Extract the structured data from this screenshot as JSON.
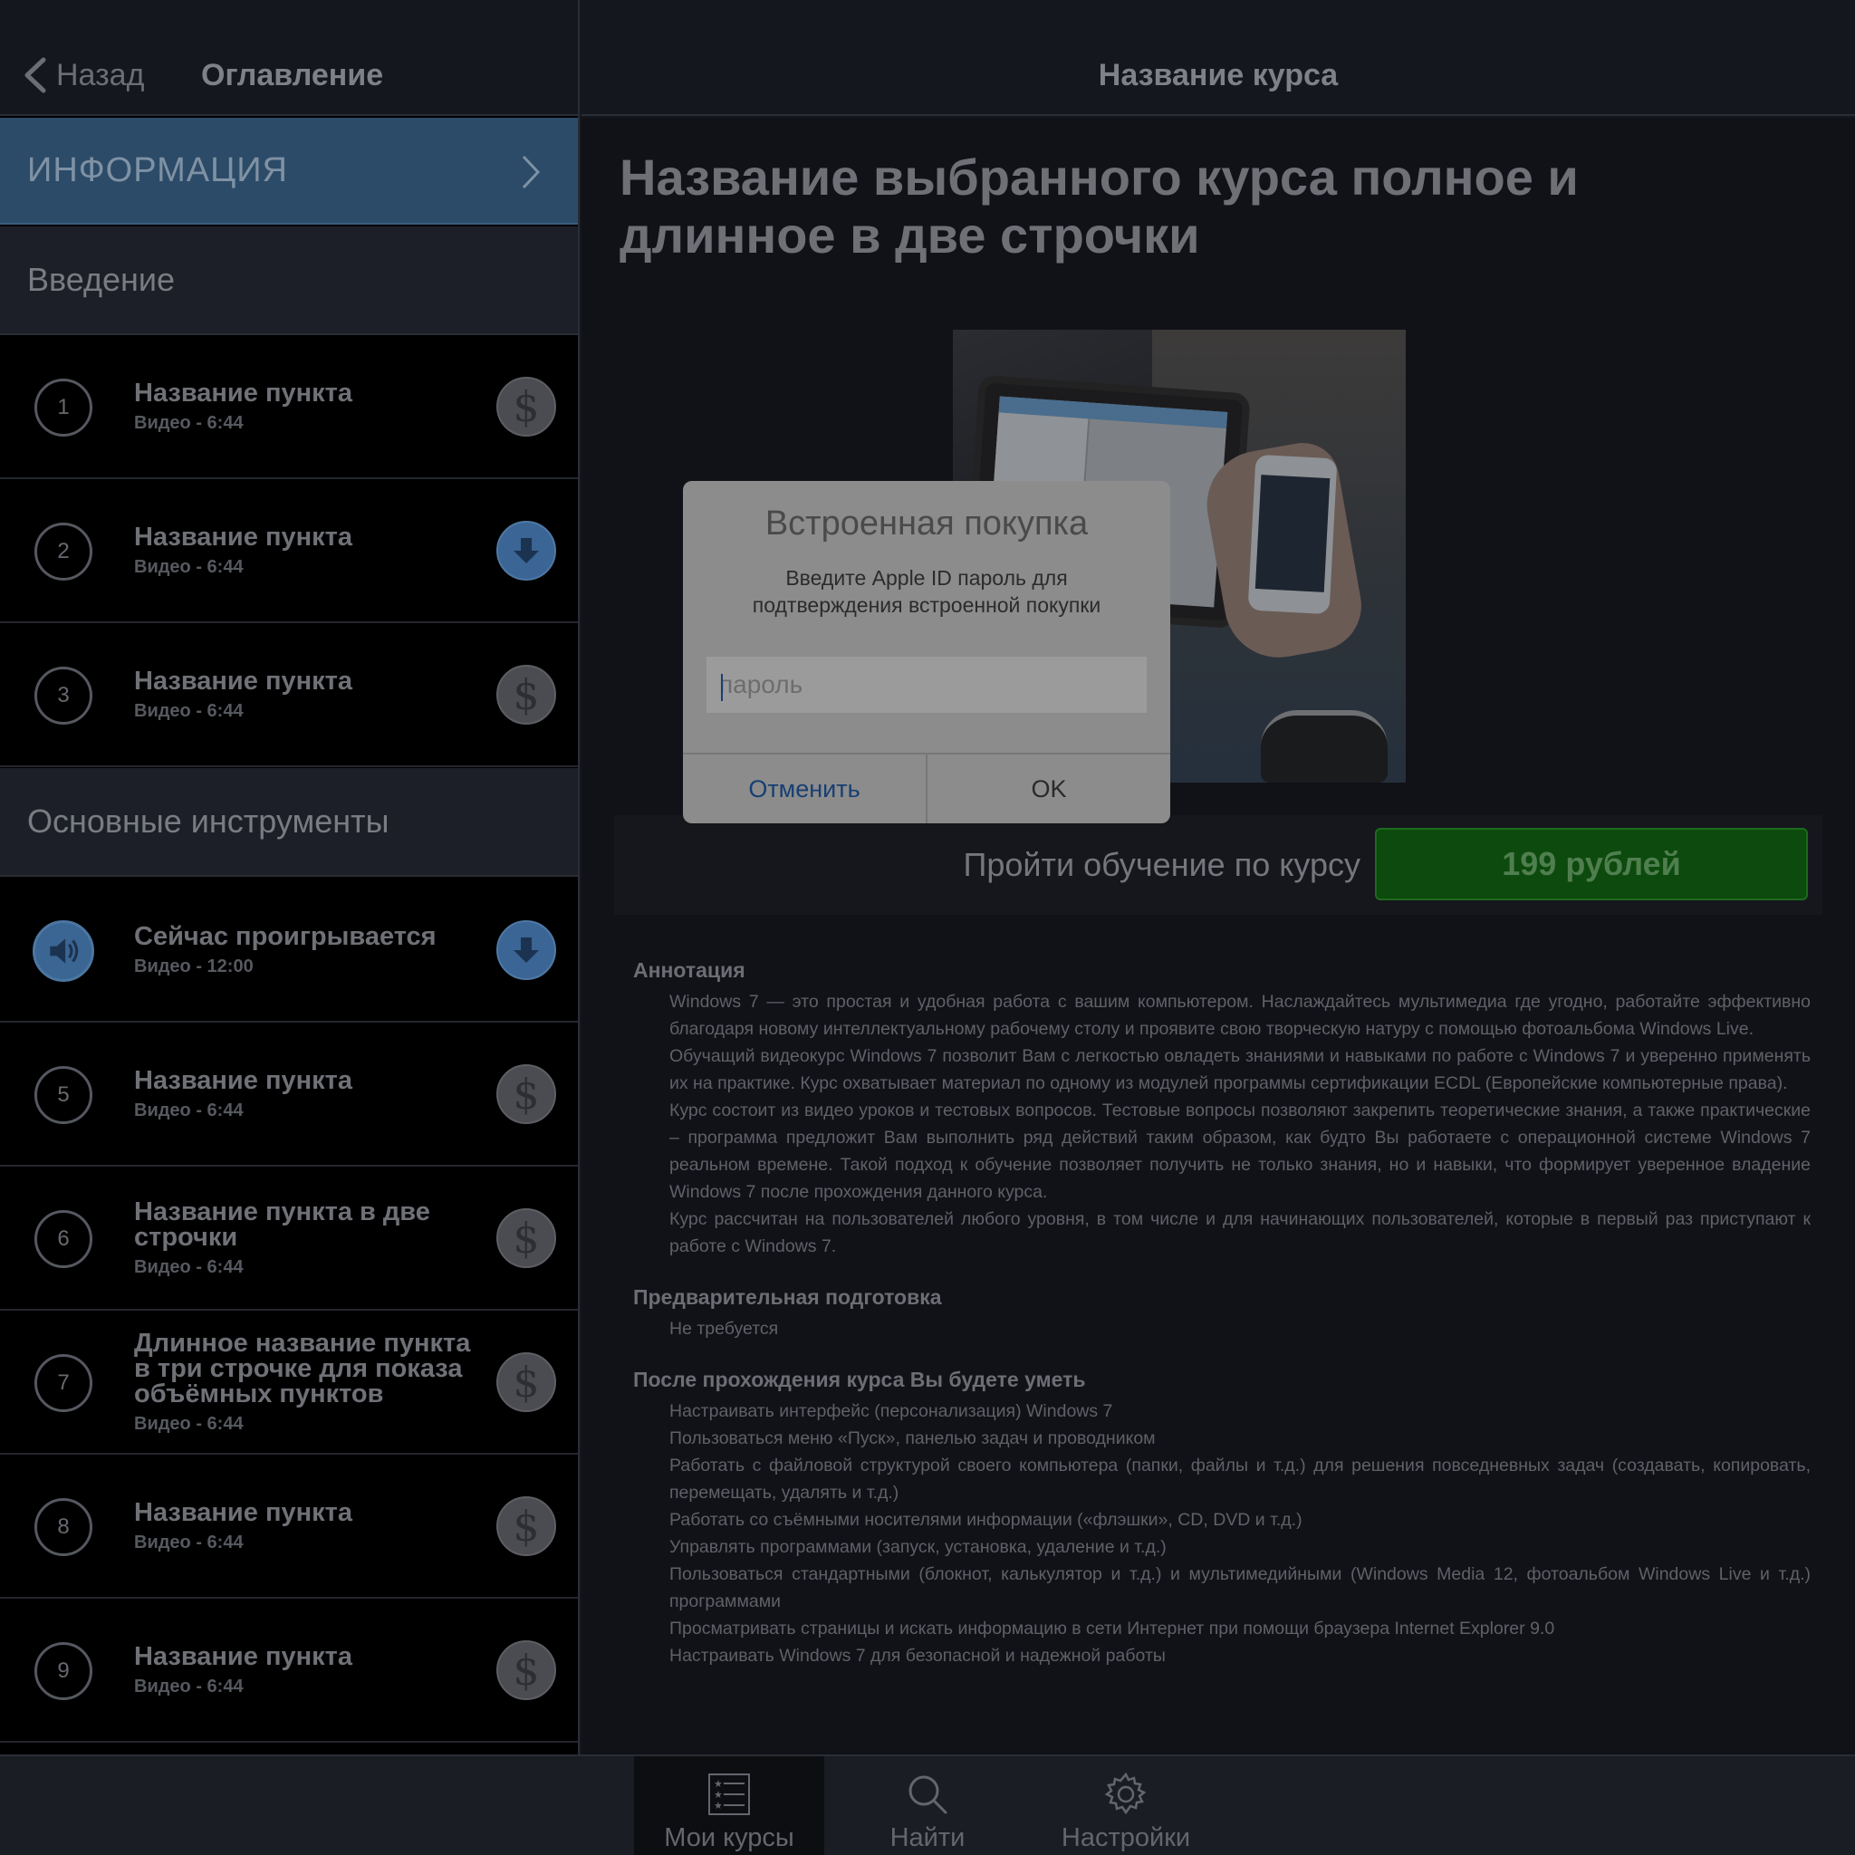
{
  "sidebar": {
    "back_label": "Назад",
    "title": "Оглавление",
    "info_label": "ИНФОРМАЦИЯ",
    "sections": [
      {
        "title": "Введение"
      },
      {
        "title": "Основные инструменты"
      }
    ],
    "lessons": [
      {
        "number": "1",
        "title": "Название пункта",
        "subtitle": "Видео - 6:44",
        "action": "dollar-icon"
      },
      {
        "number": "2",
        "title": "Название пункта",
        "subtitle": "Видео - 6:44",
        "action": "download-icon"
      },
      {
        "number": "3",
        "title": "Название пункта",
        "subtitle": "Видео - 6:44",
        "action": "dollar-icon"
      },
      {
        "number": "",
        "title": "Сейчас проигрывается",
        "subtitle": "Видео - 12:00",
        "action": "download-icon",
        "playing": true
      },
      {
        "number": "5",
        "title": "Название пункта",
        "subtitle": "Видео - 6:44",
        "action": "dollar-icon"
      },
      {
        "number": "6",
        "title": "Название пункта в две строчки",
        "subtitle": "Видео - 6:44",
        "action": "dollar-icon"
      },
      {
        "number": "7",
        "title": "Длинное название пункта в три строчке для показа объёмных пунктов",
        "subtitle": "Видео - 6:44",
        "action": "dollar-icon"
      },
      {
        "number": "8",
        "title": "Название пункта",
        "subtitle": "Видео - 6:44",
        "action": "dollar-icon"
      },
      {
        "number": "9",
        "title": "Название пункта",
        "subtitle": "Видео - 6:44",
        "action": "dollar-icon"
      }
    ]
  },
  "main": {
    "nav_title": "Название курса",
    "course_title": "Название выбранного курса полное и длинное в две строчки",
    "buy_text": "Пройти обучение по курсу",
    "price_label": "199 рублей",
    "sections": [
      {
        "title": "Аннотация",
        "paragraphs": [
          "Windows 7 — это простая и удобная работа с вашим компьютером. Наслаждайтесь мультимедиа где угодно, работайте эффективно благодаря новому интеллектуальному рабочему столу и проявите свою творческую натуру с помощью фотоальбома Windows Live.",
          "Обучащий видеокурс Windows 7 позволит Вам с легкостью овладеть знаниями и навыками по работе с Windows 7 и уверенно применять их на практике. Курс охватывает материал по одному из модулей программы сертификации ECDL (Европейские компьютерные права).",
          "Курс состоит из видео уроков и тестовых вопросов. Тестовые вопросы позволяют закрепить теоретические знания, а также практические – программа предложит Вам выполнить ряд действий таким образом, как будто Вы работаете с операционной системе Windows 7 реальном времене. Такой подход к обучение позволяет получить не только знания, но и навыки, что формирует уверенное владение Windows 7 после прохождения данного курса.",
          "Курс рассчитан на пользователей любого уровня, в том числе и для начинающих пользователей, которые в первый раз приступают к работе с Windows 7."
        ]
      },
      {
        "title": "Предварительная подготовка",
        "paragraphs": [
          "Не требуется"
        ]
      },
      {
        "title": "После прохождения курса Вы будете уметь",
        "paragraphs": [
          "Настраивать интерфейс (персонализация) Windows 7",
          "Пользоваться меню «Пуск», панелью задач и проводником",
          "Работать с файловой структурой своего компьютера (папки, файлы и т.д.) для решения повседневных задач (создавать, копировать, перемещать, удалять и т.д.)",
          "Работать со съёмными носителями информации («флэшки», CD, DVD и т.д.)",
          "Управлять программами (запуск, установка, удаление и т.д.)",
          "Пользоваться стандартными (блокнот, калькулятор и т.д.) и мультимедийными (Windows Media 12, фотоальбом Windows Live и т.д.) программами",
          "Просматривать страницы и искать информацию в сети Интернет при помощи браузера Internet Explorer 9.0",
          "Настраивать Windows 7 для безопасной и надежной работы"
        ]
      }
    ]
  },
  "dialog": {
    "title": "Встроенная покупка",
    "message": "Введите Apple ID пароль для подтверждения встроенной покупки",
    "password_placeholder": "пароль",
    "password_value": "",
    "cancel_label": "Отменить",
    "ok_label": "OK"
  },
  "tabbar": {
    "tabs": [
      {
        "label": "Мои курсы",
        "icon": "list-icon",
        "active": true
      },
      {
        "label": "Найти",
        "icon": "search-icon",
        "active": false
      },
      {
        "label": "Настройки",
        "icon": "gear-icon",
        "active": false
      }
    ]
  },
  "colors": {
    "accent_blue": "#2c4b68",
    "price_green": "#0d4a0d",
    "dialog_link": "#173f72"
  }
}
